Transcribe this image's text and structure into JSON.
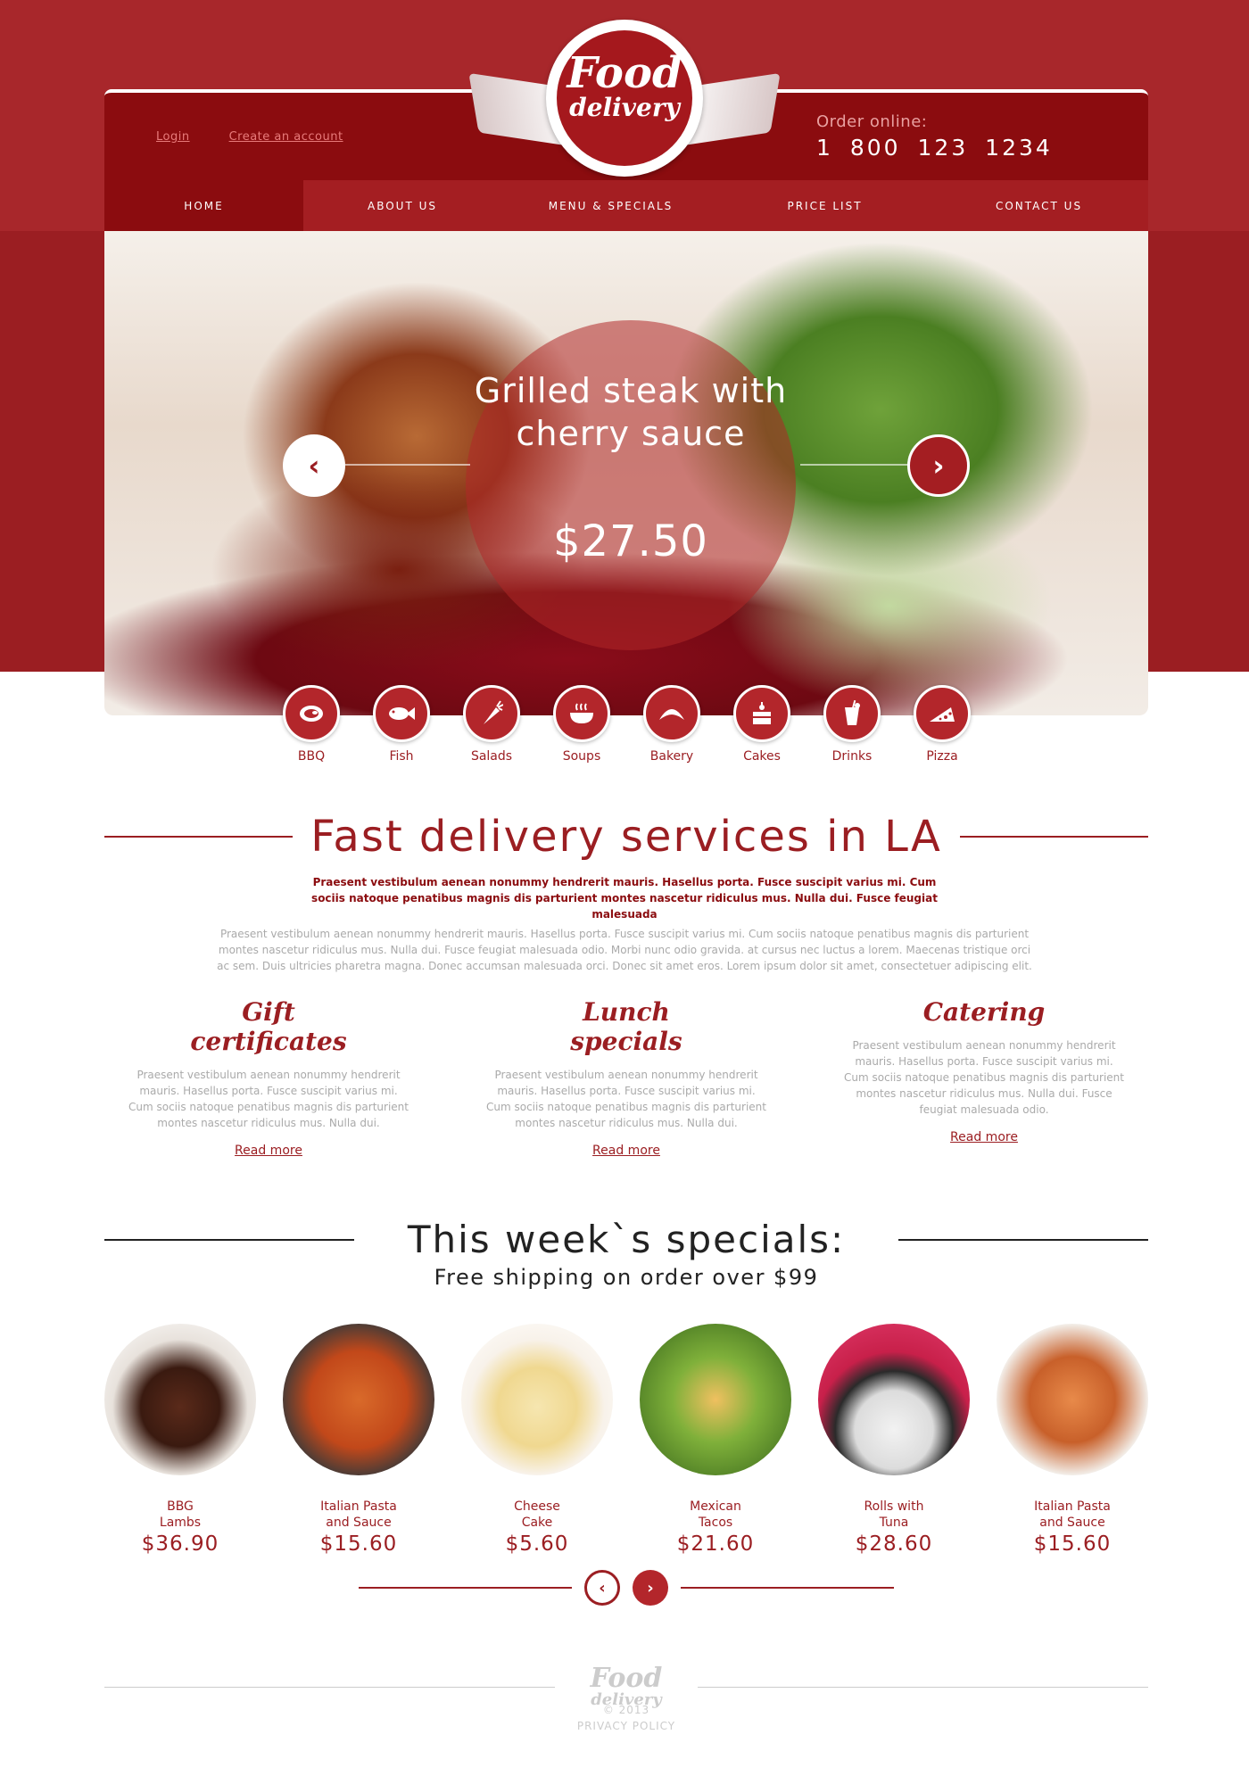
{
  "header": {
    "login_label": "Login",
    "create_account_label": "Create an account",
    "order_label": "Order online:",
    "phone": "1 800  123  1234",
    "logo_food": "Food",
    "logo_delivery": "delivery"
  },
  "nav": {
    "items": [
      "HOME",
      "ABOUT US",
      "MENU & SPECIALS",
      "PRICE LIST",
      "CONTACT US"
    ],
    "active": "HOME"
  },
  "hero": {
    "title": "Grilled steak with cherry sauce",
    "price": "$27.50",
    "prev_icon": "‹",
    "next_icon": "›"
  },
  "categories": [
    {
      "label": "BBQ",
      "icon": "steak-icon"
    },
    {
      "label": "Fish",
      "icon": "fish-icon"
    },
    {
      "label": "Salads",
      "icon": "carrot-icon"
    },
    {
      "label": "Soups",
      "icon": "soup-bowl-icon"
    },
    {
      "label": "Bakery",
      "icon": "croissant-icon"
    },
    {
      "label": "Cakes",
      "icon": "cake-icon"
    },
    {
      "label": "Drinks",
      "icon": "drink-icon"
    },
    {
      "label": "Pizza",
      "icon": "pizza-slice-icon"
    }
  ],
  "intro": {
    "title": "Fast delivery services in LA",
    "lead": "Praesent vestibulum aenean nonummy hendrerit mauris. Hasellus porta. Fusce suscipit varius mi. Cum sociis natoque penatibus magnis dis parturient montes nascetur ridiculus mus. Nulla dui. Fusce feugiat malesuada",
    "body": "Praesent vestibulum aenean nonummy hendrerit mauris. Hasellus porta. Fusce suscipit varius mi. Cum sociis natoque penatibus magnis dis parturient montes nascetur ridiculus mus. Nulla dui. Fusce feugiat malesuada odio. Morbi nunc odio gravida. at cursus nec luctus a lorem. Maecenas tristique orci ac sem. Duis ultricies pharetra magna. Donec accumsan malesuada orci. Donec sit amet eros. Lorem ipsum dolor sit amet, consectetuer adipiscing elit."
  },
  "features": [
    {
      "title": "Gift certificates",
      "text": "Praesent vestibulum aenean nonummy hendrerit mauris. Hasellus porta. Fusce suscipit varius mi. Cum sociis natoque penatibus magnis dis parturient montes nascetur ridiculus mus. Nulla dui.",
      "link": "Read more"
    },
    {
      "title": "Lunch specials",
      "text": "Praesent vestibulum aenean nonummy hendrerit mauris. Hasellus porta. Fusce suscipit varius mi. Cum sociis natoque penatibus magnis dis parturient montes nascetur ridiculus mus. Nulla dui.",
      "link": "Read more"
    },
    {
      "title": "Catering",
      "text": "Praesent vestibulum aenean nonummy hendrerit mauris. Hasellus porta. Fusce suscipit varius mi. Cum sociis natoque penatibus magnis dis parturient montes nascetur ridiculus mus. Nulla dui. Fusce feugiat malesuada odio.",
      "link": "Read more"
    }
  ],
  "specials": {
    "title": "This week`s specials:",
    "subtitle": "Free shipping on order over $99",
    "items": [
      {
        "name": "BBG Lambs",
        "price": "$36.90"
      },
      {
        "name": "Italian Pasta and Sauce",
        "price": "$15.60"
      },
      {
        "name": "Cheese Cake",
        "price": "$5.60"
      },
      {
        "name": "Mexican Tacos",
        "price": "$21.60"
      },
      {
        "name": "Rolls with Tuna",
        "price": "$28.60"
      },
      {
        "name": "Italian Pasta and Sauce",
        "price": "$15.60"
      }
    ],
    "prev_icon": "‹",
    "next_icon": "›"
  },
  "footer": {
    "logo_food": "Food",
    "logo_delivery": "delivery",
    "copyright": "© 2013",
    "privacy": "PRIVACY POLICY"
  },
  "colors": {
    "brand": "#9b1e22",
    "header_bg": "#8b0c0f",
    "accent": "#b3262b"
  }
}
